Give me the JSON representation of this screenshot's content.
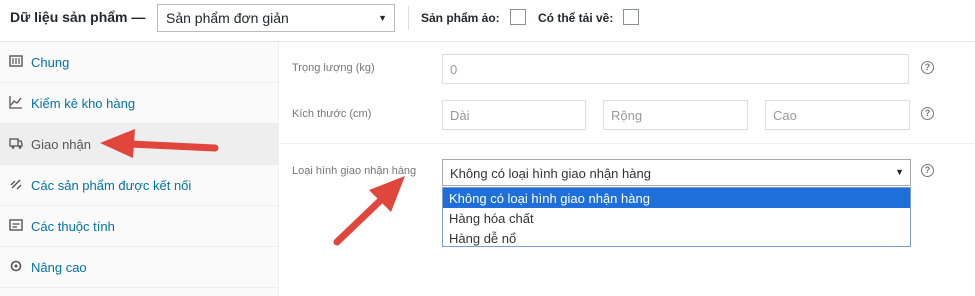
{
  "header": {
    "title": "Dữ liệu sản phẩm —",
    "product_type": "Sản phẩm đơn giản",
    "virtual_label": "Sản phẩm ảo:",
    "downloadable_label": "Có thể tải về:"
  },
  "sidebar": {
    "items": [
      {
        "label": "Chung",
        "icon": "general-icon"
      },
      {
        "label": "Kiểm kê kho hàng",
        "icon": "inventory-icon"
      },
      {
        "label": "Giao nhận",
        "icon": "shipping-truck-icon"
      },
      {
        "label": "Các sản phẩm được kết nối",
        "icon": "link-icon"
      },
      {
        "label": "Các thuộc tính",
        "icon": "attributes-icon"
      },
      {
        "label": "Nâng cao",
        "icon": "gear-icon"
      }
    ],
    "active_index": 2
  },
  "shipping": {
    "weight_label": "Trọng lượng (kg)",
    "weight_placeholder": "0",
    "dimensions_label": "Kích thước (cm)",
    "length_placeholder": "Dài",
    "width_placeholder": "Rộng",
    "height_placeholder": "Cao",
    "class_label": "Loại hình giao nhận hàng",
    "class_selected": "Không có loại hình giao nhận hàng",
    "class_options": [
      "Không có loại hình giao nhận hàng",
      "Hàng hóa chất",
      "Hàng dễ nổ"
    ],
    "help_glyph": "?"
  },
  "colors": {
    "arrow": "#e0463c",
    "link": "#0073aa",
    "option_highlight": "#1e6fd9"
  }
}
